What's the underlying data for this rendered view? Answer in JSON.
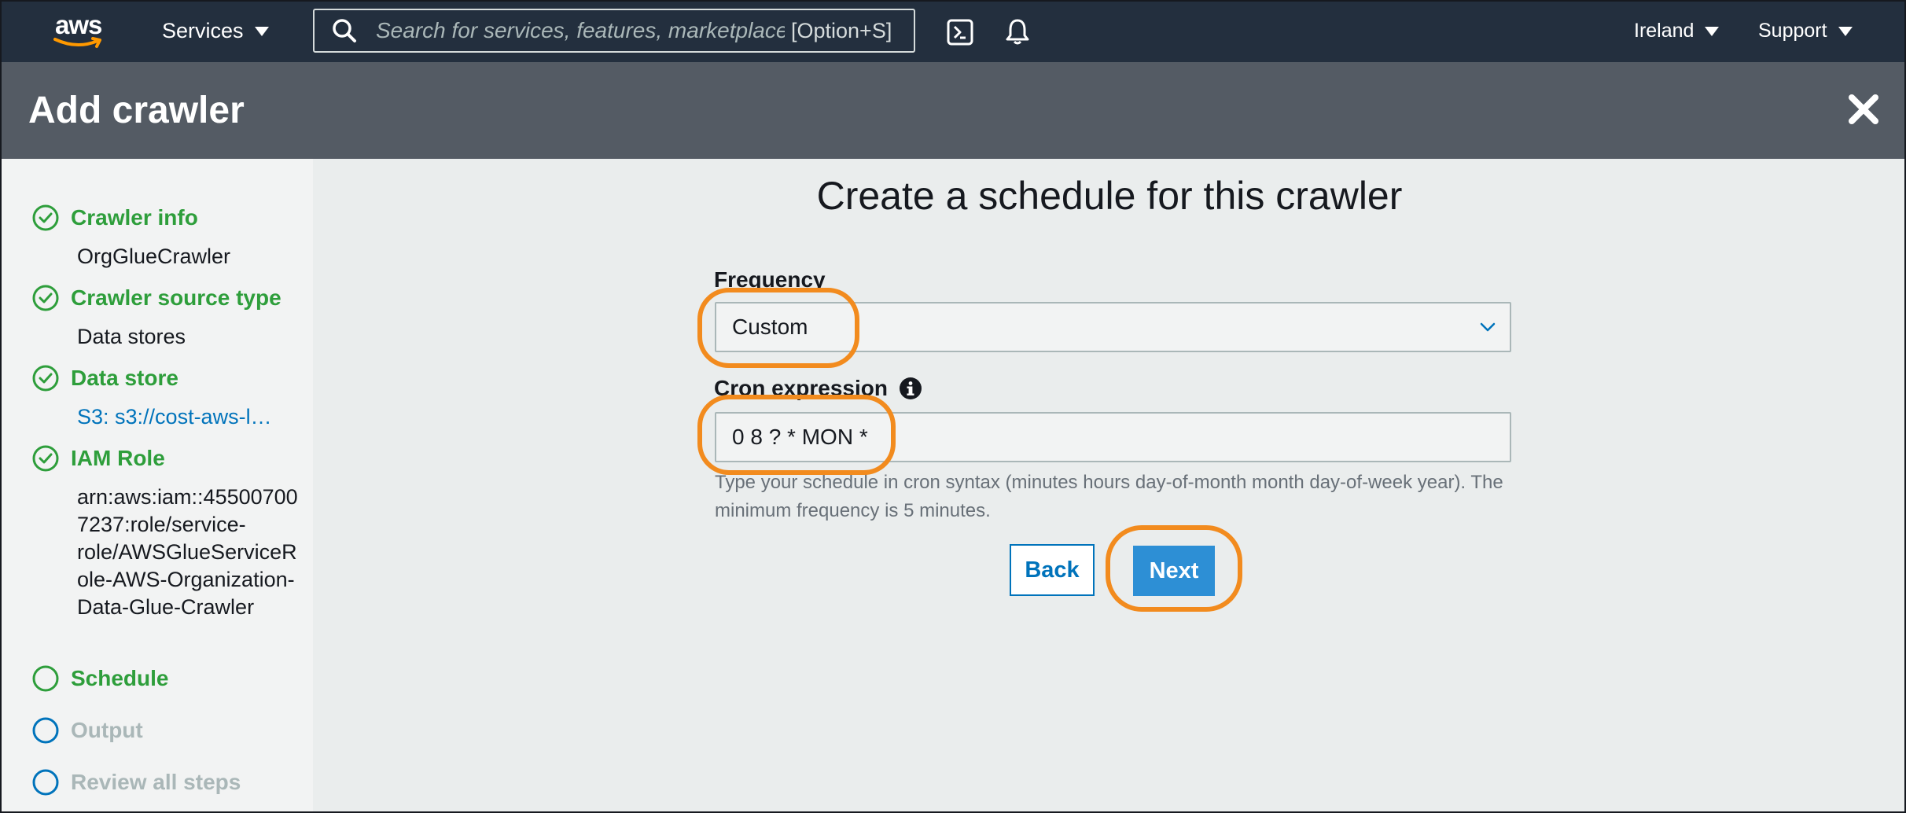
{
  "topnav": {
    "logo_text": "aws",
    "services_label": "Services",
    "search_placeholder": "Search for services, features, marketplace products, and docs",
    "search_shortcut": "[Option+S]",
    "region_label": "Ireland",
    "support_label": "Support",
    "icons": [
      "search-icon",
      "cloudshell-icon",
      "bell-icon"
    ]
  },
  "header": {
    "title": "Add crawler"
  },
  "wizard": {
    "steps": [
      {
        "label": "Crawler info",
        "status": "done",
        "detail": "OrgGlueCrawler"
      },
      {
        "label": "Crawler source type",
        "status": "done",
        "detail": "Data stores"
      },
      {
        "label": "Data store",
        "status": "done",
        "detail": "S3: s3://cost-aws-l…"
      },
      {
        "label": "IAM Role",
        "status": "done",
        "detail": "arn:aws:iam::455007007237:role/service-role/AWSGlueServiceRole-AWS-Organization-Data-Glue-Crawler"
      },
      {
        "label": "Schedule",
        "status": "current",
        "detail": ""
      },
      {
        "label": "Output",
        "status": "pending",
        "detail": ""
      },
      {
        "label": "Review all steps",
        "status": "pending",
        "detail": ""
      }
    ]
  },
  "form": {
    "title": "Create a schedule for this crawler",
    "frequency_label": "Frequency",
    "frequency_value": "Custom",
    "cron_label": "Cron expression",
    "cron_value": "0 8 ? * MON *",
    "cron_help": "Type your schedule in cron syntax (minutes hours day-of-month month day-of-week year). The minimum frequency is 5 minutes.",
    "back_label": "Back",
    "next_label": "Next"
  },
  "colors": {
    "nav_bg": "#232f3e",
    "header_bg": "#545b64",
    "step_done": "#2e9e3b",
    "step_pending": "#0073bb",
    "primary_button": "#2d8fd5",
    "highlight": "#f28b1e"
  }
}
